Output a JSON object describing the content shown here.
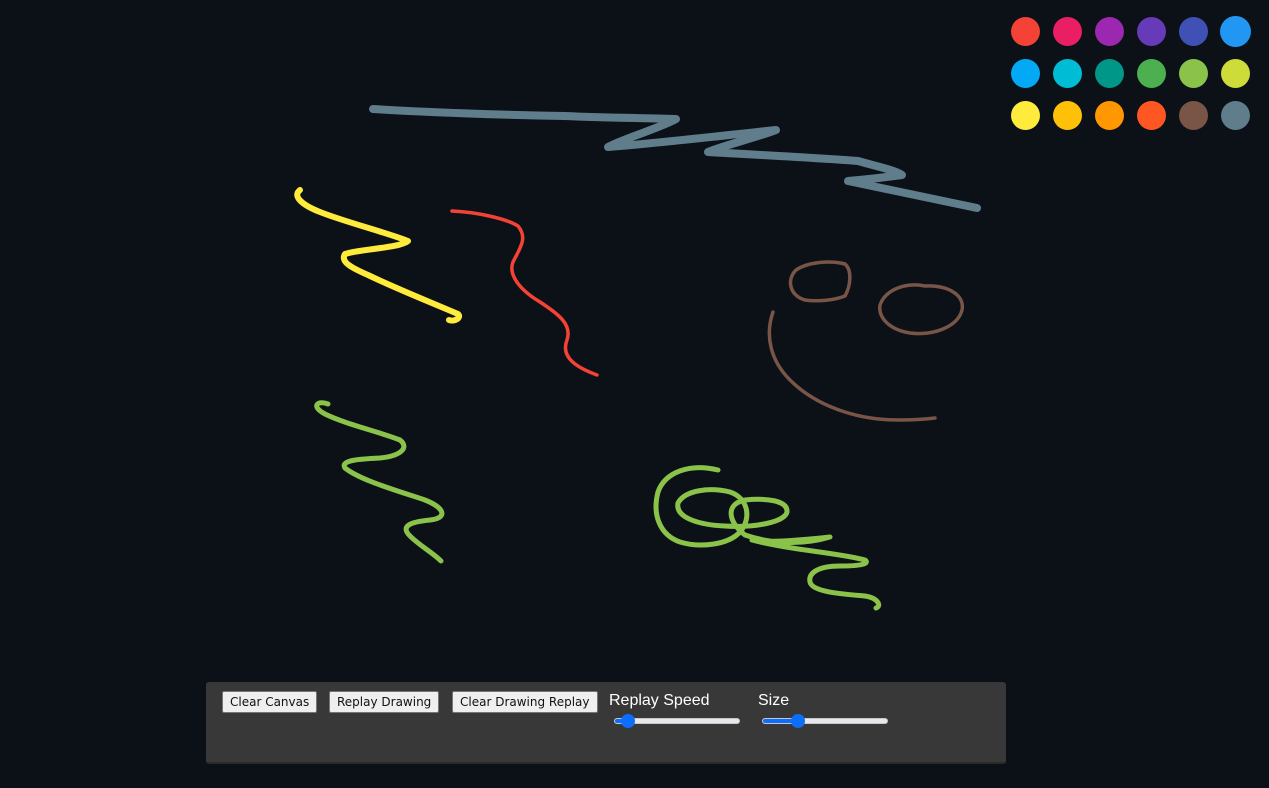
{
  "palette": {
    "colors": [
      "#f44336",
      "#e91e63",
      "#9c27b0",
      "#673ab7",
      "#3f51b5",
      "#2196f3",
      "#03a9f4",
      "#00bcd4",
      "#009688",
      "#4caf50",
      "#8bc34a",
      "#cddc39",
      "#ffeb3b",
      "#ffc107",
      "#ff9800",
      "#ff5722",
      "#795548",
      "#607d8b"
    ],
    "selected_index": 5
  },
  "controls": {
    "clear_canvas_label": "Clear Canvas",
    "replay_drawing_label": "Replay Drawing",
    "clear_replay_label": "Clear Drawing Replay",
    "replay_speed_label": "Replay Speed",
    "replay_speed_value": 0.05,
    "size_label": "Size",
    "size_value": 0.25
  },
  "colors": {
    "background": "#0c1118",
    "panel": "#383838",
    "accent": "#0d6efd"
  }
}
